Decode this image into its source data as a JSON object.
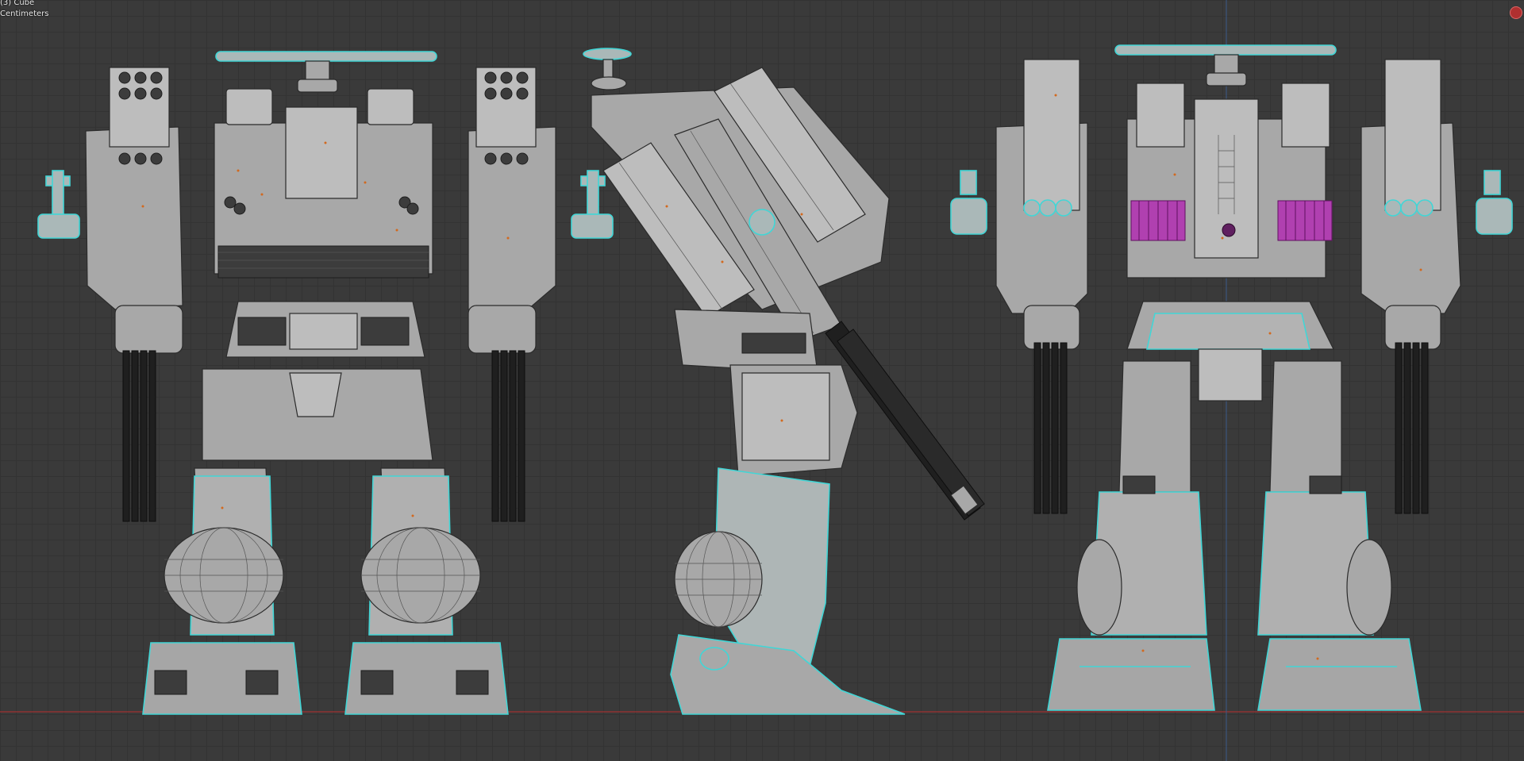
{
  "viewport": {
    "object_info": "(3) Cube",
    "units": "Centimeters"
  },
  "colors": {
    "background": "#3a3a3a",
    "grid": "#333333",
    "selection_outline": "#41d6d6",
    "mesh": "#a8a8a8",
    "vent": "#b040b0",
    "x_axis": "#a03232",
    "z_axis": "#3a5a8a"
  },
  "views": [
    {
      "name": "back-view"
    },
    {
      "name": "side-view"
    },
    {
      "name": "front-view"
    }
  ],
  "icons": {
    "record": "record-icon"
  }
}
